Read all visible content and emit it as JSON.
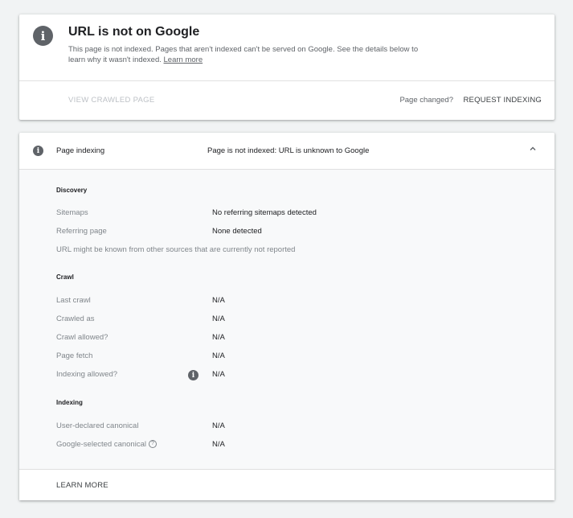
{
  "summary": {
    "title": "URL is not on Google",
    "description": "This page is not indexed. Pages that aren't indexed can't be served on Google. See the details below to learn why it wasn't indexed.",
    "learn_more_link": "Learn more",
    "view_crawled_page": "VIEW CRAWLED PAGE",
    "page_changed": "Page changed?",
    "request_indexing": "REQUEST INDEXING",
    "icon": "info-icon"
  },
  "details": {
    "header_label": "Page indexing",
    "header_status": "Page is not indexed: URL is unknown to Google",
    "discovery": {
      "title": "Discovery",
      "sitemaps_label": "Sitemaps",
      "sitemaps_value": "No referring sitemaps detected",
      "referring_label": "Referring page",
      "referring_value": "None detected",
      "note": "URL might be known from other sources that are currently not reported"
    },
    "crawl": {
      "title": "Crawl",
      "last_crawl_label": "Last crawl",
      "last_crawl_value": "N/A",
      "crawled_as_label": "Crawled as",
      "crawled_as_value": "N/A",
      "crawl_allowed_label": "Crawl allowed?",
      "crawl_allowed_value": "N/A",
      "page_fetch_label": "Page fetch",
      "page_fetch_value": "N/A",
      "indexing_allowed_label": "Indexing allowed?",
      "indexing_allowed_value": "N/A"
    },
    "indexing": {
      "title": "Indexing",
      "user_canonical_label": "User-declared canonical",
      "user_canonical_value": "N/A",
      "google_canonical_label": "Google-selected canonical",
      "google_canonical_value": "N/A"
    },
    "footer_learn_more": "LEARN MORE"
  }
}
